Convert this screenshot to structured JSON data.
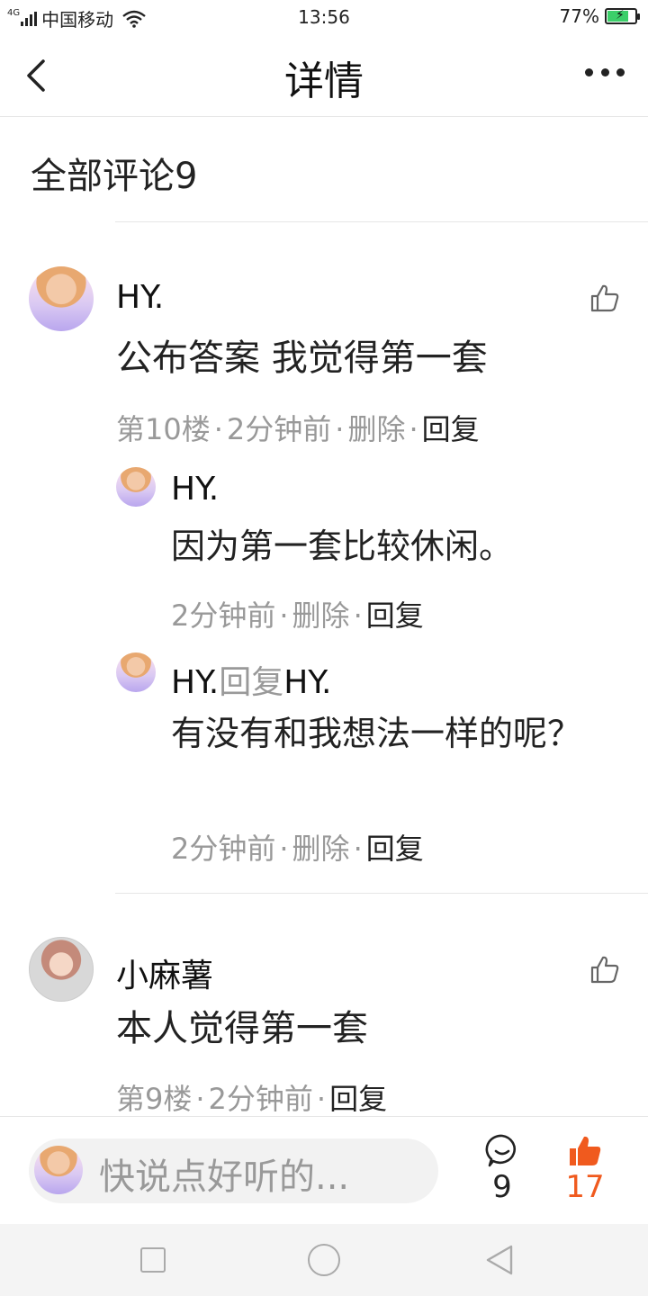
{
  "status_bar": {
    "network_type": "4G",
    "carrier": "中国移动",
    "time": "13:56",
    "battery": "77%"
  },
  "nav": {
    "title": "详情"
  },
  "comments_header": {
    "title": "全部评论9"
  },
  "comments": [
    {
      "username": "HY.",
      "text": "公布答案 我觉得第一套",
      "floor": "第10楼",
      "time": "2分钟前",
      "delete": "删除",
      "reply": "回复",
      "replies": [
        {
          "username": "HY.",
          "text": "因为第一套比较休闲。",
          "time": "2分钟前",
          "delete": "删除",
          "reply": "回复"
        },
        {
          "username": "HY.",
          "reply_word": "回复",
          "reply_to": "HY.",
          "text": "有没有和我想法一样的呢？",
          "time": "2分钟前",
          "delete": "删除",
          "reply": "回复"
        }
      ]
    },
    {
      "username": "小麻薯",
      "text": "本人觉得第一套",
      "floor": "第9楼",
      "time": "2分钟前",
      "reply": "回复"
    }
  ],
  "bottom_bar": {
    "placeholder": "快说点好听的...",
    "comment_count": "9",
    "like_count": "17",
    "like_color": "#f05a1e"
  },
  "sep": "·"
}
